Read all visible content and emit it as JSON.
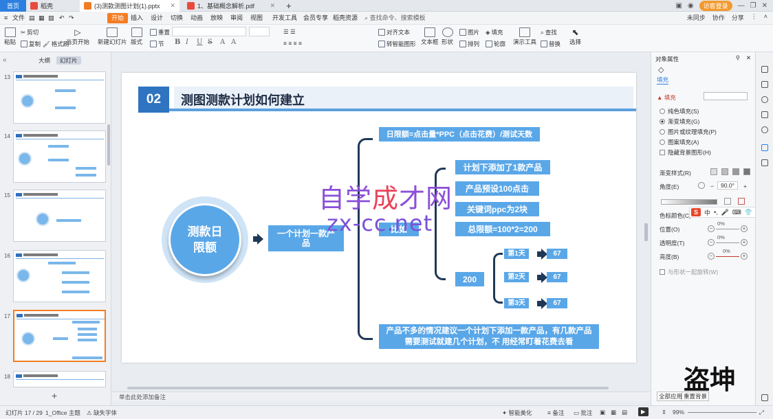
{
  "tabbar": {
    "home": "首页",
    "tabs": [
      {
        "label": "稻壳",
        "color": "#e84b3c"
      },
      {
        "label": "(3)测款测图计划(1).pptx",
        "color": "#f07d25"
      },
      {
        "label": "1、基础概念解析.pdf",
        "color": "#e84b3c"
      }
    ],
    "login": "访客登录"
  },
  "menubar": {
    "file": "文件",
    "items": [
      "开始",
      "插入",
      "设计",
      "切换",
      "动画",
      "放映",
      "审阅",
      "视图",
      "开发工具",
      "会员专享",
      "稻壳资源"
    ],
    "active": "开始",
    "search": "查找命令、搜索模板",
    "right": [
      "未同步",
      "协作",
      "分享"
    ]
  },
  "toolbar": {
    "paste": "粘贴",
    "cut": "剪切",
    "copy": "复制",
    "format_painter": "格式刷",
    "from_current": "当页开始",
    "new_slide": "新建幻灯片",
    "layout": "版式",
    "section": "节",
    "reset": "重置",
    "text_box": "文本框",
    "shape": "形状",
    "arrange": "排列",
    "outline": "轮廓",
    "align_text": "对齐文本",
    "convert_smartart": "转智能图形",
    "picture": "图片",
    "fill": "填充",
    "presenter": "演示工具",
    "find": "查找",
    "replace": "替换",
    "select": "选择",
    "bold": "B",
    "italic": "I",
    "underline": "U",
    "strike": "S"
  },
  "leftpanel": {
    "tabs": [
      "大纲",
      "幻灯片"
    ],
    "active_tab": "幻灯片",
    "slides": [
      13,
      14,
      15,
      16,
      17,
      18
    ],
    "active_slide": 17
  },
  "slide": {
    "number": "02",
    "title": "测图测款计划如何建立",
    "center": "测款日限额",
    "plan": "一个计划一款产品",
    "daily_limit": "日限额=点击量*PPC（点击花费）/测试天数",
    "example_label": "比如",
    "items": [
      "计划下添加了1款产品",
      "产品预设100点击",
      "关键词ppc为2块",
      "总限额=100*2=200"
    ],
    "total": "200",
    "days": [
      {
        "label": "第1天",
        "value": "67"
      },
      {
        "label": "第2天",
        "value": "67"
      },
      {
        "label": "第3天",
        "value": "67"
      }
    ],
    "note": "产品不多的情况建议一个计划下添加一款产品，有几款产品需要测试就建几个计划，不 用经常盯着花费去看"
  },
  "watermark": {
    "cn_a": "自学",
    "cn_b": "成",
    "cn_c": "才网",
    "url": "zx-cc.net"
  },
  "notes_placeholder": "单击此处添加备注",
  "rightpanel": {
    "title": "对象属性",
    "tab": "填充",
    "section": "填充",
    "options": [
      {
        "label": "纯色填充(S)",
        "checked": false
      },
      {
        "label": "渐变填充(G)",
        "checked": true
      },
      {
        "label": "图片或纹理填充(P)",
        "checked": false
      },
      {
        "label": "图案填充(A)",
        "checked": false
      }
    ],
    "hide_bg": "隐藏背景图形(H)",
    "gradient_style": "渐变样式(R)",
    "angle_label": "角度(E)",
    "angle_value": "90.0°",
    "stop_color": "色标颜色(C)",
    "position_label": "位置(O)",
    "position_value": "0%",
    "transparency_label": "透明度(T)",
    "transparency_value": "0%",
    "brightness_label": "亮度(B)",
    "brightness_value": "0%",
    "rotate_with_shape": "与形状一起旋转(W)",
    "apply_all": "全部应用",
    "reset_bg": "重置背景"
  },
  "ime": {
    "logo": "S",
    "mode": "中"
  },
  "signature": "盗坤",
  "statusbar": {
    "slide_pos": "幻灯片 17 / 29",
    "theme": "1_Office 主题",
    "missing_font": "缺失字体",
    "beautify": "智能美化",
    "notes": "备注",
    "comment": "批注",
    "zoom": "99%"
  }
}
